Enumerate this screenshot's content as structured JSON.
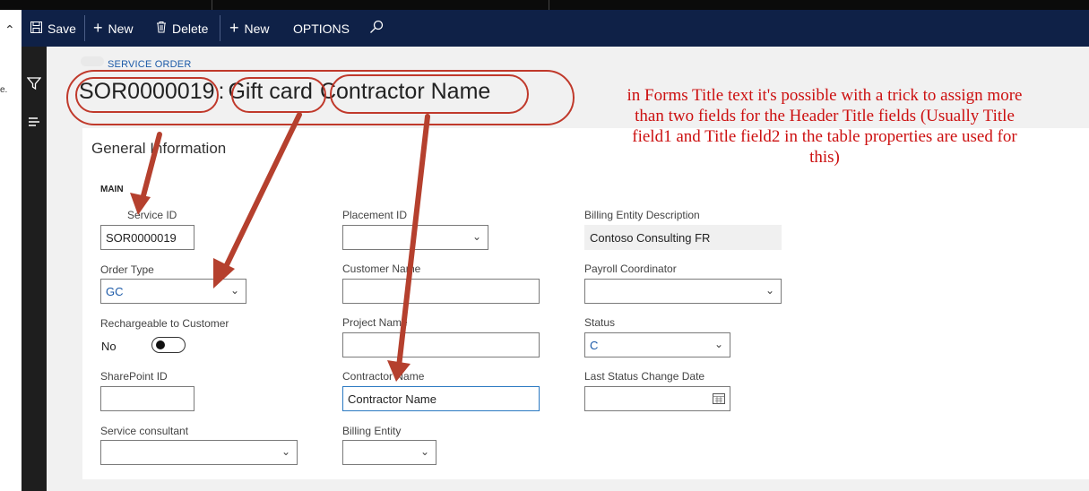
{
  "window": {
    "left_gutter_char": "e."
  },
  "action_pane": {
    "save_label": "Save",
    "new_label": "New",
    "delete_label": "Delete",
    "new2_label": "New",
    "options_label": "OPTIONS",
    "icons": [
      "save-icon",
      "plus-icon",
      "trash-icon",
      "plus-icon",
      "search-icon"
    ]
  },
  "nav_rail": {
    "icons": [
      "filter-icon",
      "menu-icon"
    ]
  },
  "breadcrumb": "SERVICE ORDER",
  "title": {
    "part1": "SOR0000019",
    "separator": ":",
    "part2": "Gift card",
    "part3": "Contractor Name"
  },
  "section": {
    "title": "General Information",
    "group_label": "MAIN"
  },
  "fields": {
    "service_id": {
      "label": "Service ID",
      "value": "SOR0000019"
    },
    "order_type": {
      "label": "Order Type",
      "value": "GC"
    },
    "rechargeable": {
      "label": "Rechargeable to Customer",
      "value": "No"
    },
    "sharepoint_id": {
      "label": "SharePoint ID",
      "value": ""
    },
    "service_consultant": {
      "label": "Service consultant",
      "value": ""
    },
    "placement_id": {
      "label": "Placement ID",
      "value": ""
    },
    "customer_name": {
      "label": "Customer Name",
      "value": ""
    },
    "project_name": {
      "label": "Project Name",
      "value": ""
    },
    "contractor_name": {
      "label": "Contractor Name",
      "value": "Contractor Name"
    },
    "billing_entity": {
      "label": "Billing Entity",
      "value": ""
    },
    "billing_entity_description": {
      "label": "Billing Entity Description",
      "value": "Contoso Consulting FR"
    },
    "payroll_coordinator": {
      "label": "Payroll Coordinator",
      "value": ""
    },
    "status": {
      "label": "Status",
      "value": "C"
    },
    "last_status_change_date": {
      "label": "Last Status Change Date",
      "value": ""
    }
  },
  "annotation": {
    "text": "in Forms Title text it's possible with a trick to assign more than two fields for the Header Title fields (Usually Title field1 and Title field2 in the table properties are used for this)"
  },
  "colors": {
    "action_pane": "#0f2147",
    "nav_rail": "#1e1e1e",
    "annotation_red": "#cc1010",
    "arrow_red": "#b5402e",
    "link_blue": "#1c5aa8"
  }
}
